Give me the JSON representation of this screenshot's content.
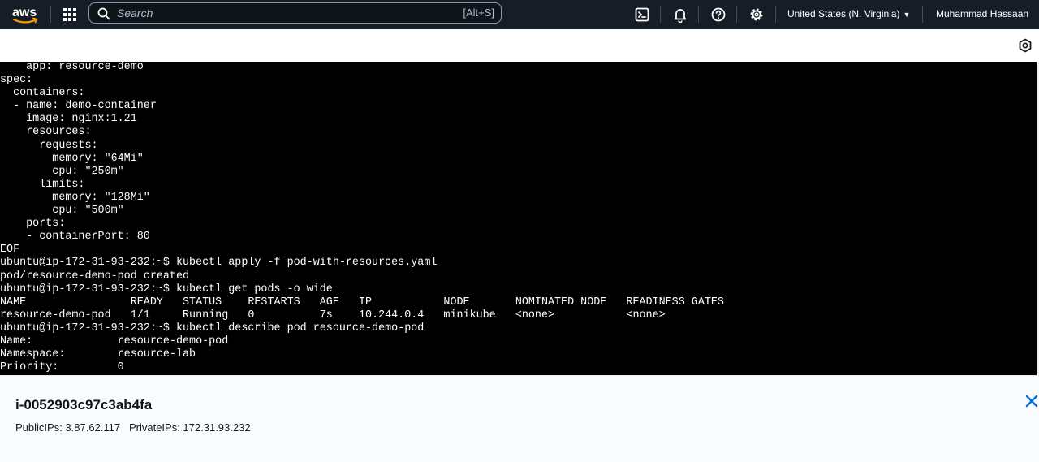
{
  "nav": {
    "logo_text": "aws",
    "search_placeholder": "Search",
    "search_shortcut": "[Alt+S]",
    "region": "United States (N. Virginia)",
    "user": "Muhammad Hassaan",
    "icons": [
      "services-grid-icon",
      "search-icon",
      "cloudshell-icon",
      "bell-icon",
      "help-icon",
      "settings-icon"
    ]
  },
  "terminal": {
    "lines": [
      "    app: resource-demo",
      "spec:",
      "  containers:",
      "  - name: demo-container",
      "    image: nginx:1.21",
      "    resources:",
      "      requests:",
      "        memory: \"64Mi\"",
      "        cpu: \"250m\"",
      "      limits:",
      "        memory: \"128Mi\"",
      "        cpu: \"500m\"",
      "    ports:",
      "    - containerPort: 80",
      "EOF",
      "ubuntu@ip-172-31-93-232:~$ kubectl apply -f pod-with-resources.yaml",
      "pod/resource-demo-pod created",
      "ubuntu@ip-172-31-93-232:~$ kubectl get pods -o wide",
      "NAME                READY   STATUS    RESTARTS   AGE   IP           NODE       NOMINATED NODE   READINESS GATES",
      "resource-demo-pod   1/1     Running   0          7s    10.244.0.4   minikube   <none>           <none>",
      "ubuntu@ip-172-31-93-232:~$ kubectl describe pod resource-demo-pod",
      "Name:             resource-demo-pod",
      "Namespace:        resource-lab",
      "Priority:         0"
    ]
  },
  "instance": {
    "id": "i-0052903c97c3ab4fa",
    "ips": "PublicIPs: 3.87.62.117   PrivateIPs: 172.31.93.232"
  },
  "colors": {
    "nav_bg": "#161d26",
    "aws_orange": "#ff9900",
    "terminal_bg": "#000000",
    "terminal_fg": "#ffffff",
    "close_blue": "#006ce0"
  }
}
